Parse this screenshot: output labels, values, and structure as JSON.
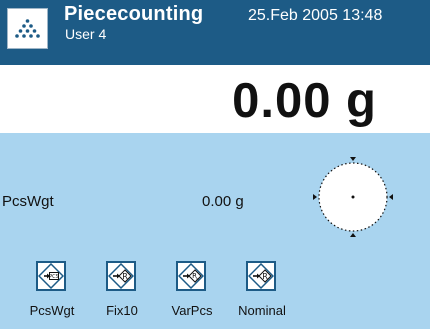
{
  "header": {
    "icon": "pieces-dots-icon",
    "title": "Piececounting",
    "user": "User 4",
    "datetime": "25.Feb 2005  13:48"
  },
  "weight": {
    "value": "0.00 g"
  },
  "info": {
    "label": "PcsWgt",
    "value": "0.00 g"
  },
  "buttons": [
    {
      "label": "PcsWgt",
      "icon": "pcs-diamond-icon"
    },
    {
      "label": "Fix10",
      "icon": "ref-diamond-icon"
    },
    {
      "label": "VarPcs",
      "icon": "ref-n-diamond-icon"
    },
    {
      "label": "Nominal",
      "icon": "ref-diamond-icon"
    }
  ],
  "colors": {
    "header_bg": "#1d5b86",
    "panel_bg": "#a9d4ef",
    "accent": "#1d5b86"
  }
}
